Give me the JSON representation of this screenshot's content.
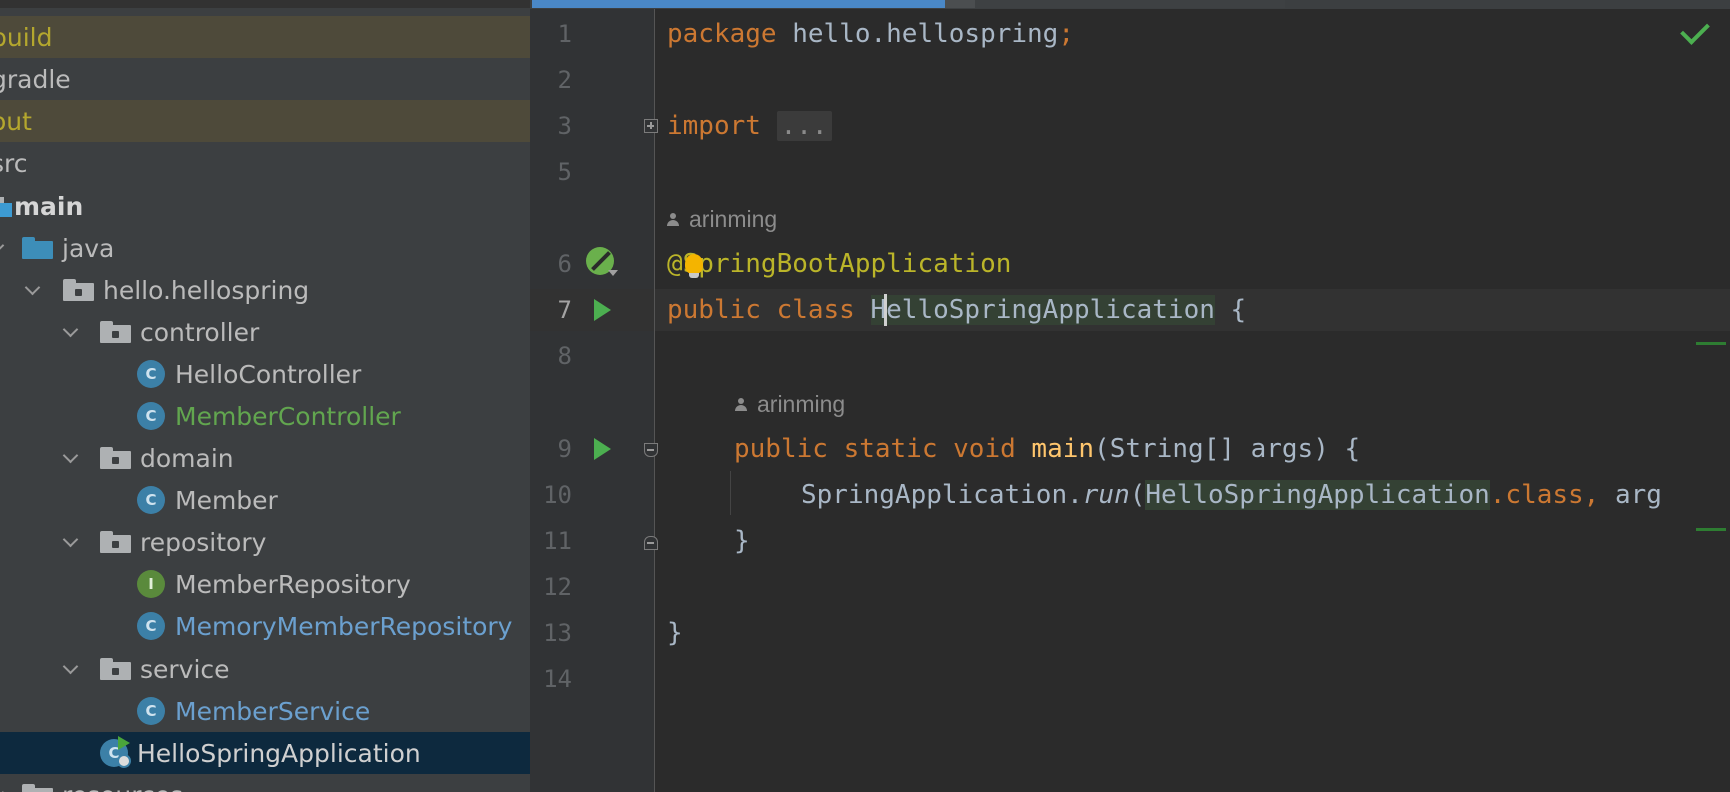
{
  "project_tree": {
    "items": [
      {
        "label": "build"
      },
      {
        "label": "gradle"
      },
      {
        "label": "out"
      },
      {
        "label": "src"
      },
      {
        "label": "main"
      },
      {
        "label": "java"
      },
      {
        "label": "hello.hellospring"
      },
      {
        "label": "controller"
      },
      {
        "label": "HelloController",
        "icon_letter": "C"
      },
      {
        "label": "MemberController",
        "icon_letter": "C"
      },
      {
        "label": "domain"
      },
      {
        "label": "Member",
        "icon_letter": "C"
      },
      {
        "label": "repository"
      },
      {
        "label": "MemberRepository",
        "icon_letter": "I"
      },
      {
        "label": "MemoryMemberRepository",
        "icon_letter": "C"
      },
      {
        "label": "service"
      },
      {
        "label": "MemberService",
        "icon_letter": "C"
      },
      {
        "label": "HelloSpringApplication",
        "icon_letter": "C"
      },
      {
        "label": "resources"
      }
    ]
  },
  "editor": {
    "line_numbers": [
      "1",
      "2",
      "3",
      "5",
      "6",
      "7",
      "8",
      "9",
      "10",
      "11",
      "12",
      "13",
      "14"
    ],
    "author_hints": [
      "arinming",
      "arinming"
    ],
    "tokens": {
      "package_kw": "package",
      "package_name": " hello.hellospring",
      "semicolon": ";",
      "import_kw": "import",
      "fold_dots": "...",
      "annotation": "@SpringBootApplication",
      "public_class": "public class ",
      "class_name": "HelloSpringApplication",
      "open_brace": " {",
      "method_modifiers": "public static void ",
      "method_name": "main",
      "method_params": "(String[] args) {",
      "call_receiver": "SpringApplication.",
      "call_method": "run",
      "call_open": "(",
      "call_arg_class": "HelloSpringApplication",
      "call_dot_class": ".class, ",
      "call_args_rest": "arg",
      "close_brace": "}"
    }
  },
  "colors": {
    "keyword": "#cc7832",
    "annotation": "#bbb529",
    "method": "#ffc66d",
    "plain": "#a9b7c6",
    "excluded_folder": "#b4a72e",
    "modified_file": "#62a64f",
    "new_file": "#6ba0cf",
    "selection": "#0d293e"
  }
}
